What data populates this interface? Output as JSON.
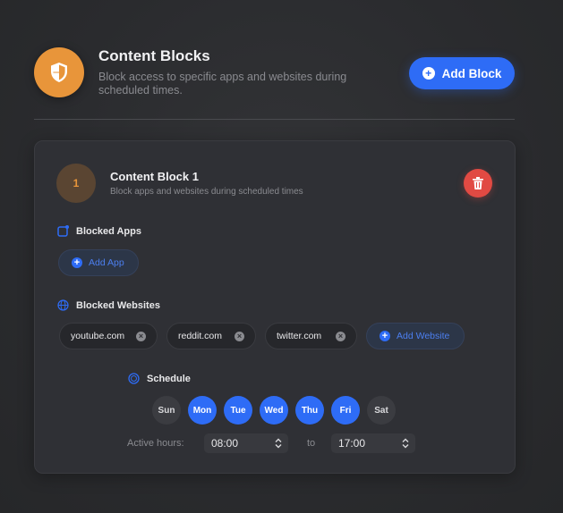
{
  "header": {
    "title": "Content Blocks",
    "description": "Block access to specific apps and websites during scheduled times.",
    "add_block_label": "Add Block",
    "icon": "shield-icon",
    "accent": "#e8953a"
  },
  "block": {
    "number": "1",
    "title": "Content Block 1",
    "subtitle": "Block apps and websites during scheduled times",
    "delete_icon": "trash-icon",
    "apps": {
      "label": "Blocked Apps",
      "add_label": "Add App"
    },
    "websites": {
      "label": "Blocked Websites",
      "items": [
        "youtube.com",
        "reddit.com",
        "twitter.com"
      ],
      "add_label": "Add Website"
    },
    "schedule": {
      "label": "Schedule",
      "days": [
        {
          "label": "Sun",
          "active": false
        },
        {
          "label": "Mon",
          "active": true
        },
        {
          "label": "Tue",
          "active": true
        },
        {
          "label": "Wed",
          "active": true
        },
        {
          "label": "Thu",
          "active": true
        },
        {
          "label": "Fri",
          "active": true
        },
        {
          "label": "Sat",
          "active": false
        }
      ],
      "active_hours_label": "Active hours:",
      "start_time": "08:00",
      "to_label": "to",
      "end_time": "17:00"
    }
  },
  "colors": {
    "primary": "#2e6cf6",
    "danger": "#e14a43",
    "background": "#2b2c2f"
  }
}
